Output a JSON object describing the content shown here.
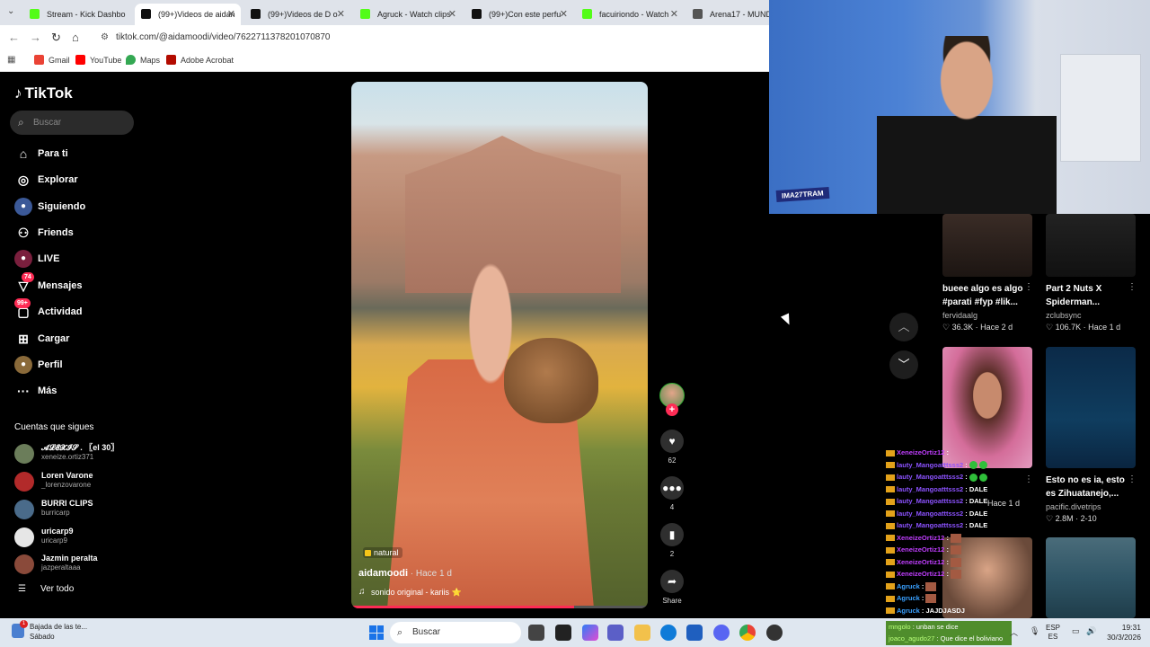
{
  "browser": {
    "tabs": [
      {
        "label": "Stream - Kick Dashbo",
        "color": "#53fc18"
      },
      {
        "label": "(99+)Videos de aidan",
        "color": "#111111",
        "active": true
      },
      {
        "label": "(99+)Videos de D o",
        "color": "#111111"
      },
      {
        "label": "Agruck - Watch clips",
        "color": "#53fc18"
      },
      {
        "label": "(99+)Con este perfu",
        "color": "#111111"
      },
      {
        "label": "facuiriondo - Watch",
        "color": "#53fc18"
      },
      {
        "label": "Arena17 - MUNDIA",
        "color": "#555555"
      }
    ],
    "url": "tiktok.com/@aidamoodi/video/7622711378201070870",
    "bookmarks": [
      {
        "label": "Gmail",
        "color": "#ea4335"
      },
      {
        "label": "YouTube",
        "color": "#ff0000"
      },
      {
        "label": "Maps",
        "color": "#34a853"
      },
      {
        "label": "Adobe Acrobat",
        "color": "#b30b00"
      }
    ]
  },
  "tiktok": {
    "logo": "TikTok",
    "search_placeholder": "Buscar",
    "menu": [
      {
        "label": "Para ti",
        "icon": "home-icon"
      },
      {
        "label": "Explorar",
        "icon": "compass-icon"
      },
      {
        "label": "Siguiendo",
        "icon": "following-icon"
      },
      {
        "label": "Friends",
        "icon": "friends-icon"
      },
      {
        "label": "LIVE",
        "icon": "live-icon"
      },
      {
        "label": "Mensajes",
        "icon": "messages-icon",
        "badge": "74"
      },
      {
        "label": "Actividad",
        "icon": "activity-icon",
        "badge": "99+"
      },
      {
        "label": "Cargar",
        "icon": "upload-icon"
      },
      {
        "label": "Perfil",
        "icon": "profile-icon"
      },
      {
        "label": "Más",
        "icon": "more-icon"
      }
    ],
    "following_title": "Cuentas que sigues",
    "accounts": [
      {
        "name": "𝓐𝓛𝓔𝓧𝓘𝓢 . 〖el 30〗",
        "handle": "xeneize.ortiz371"
      },
      {
        "name": "Loren Varone",
        "handle": "_lorenzovarone"
      },
      {
        "name": "BURRI CLIPS",
        "handle": "burricarp"
      },
      {
        "name": "uricarp9",
        "handle": "uricarp9"
      },
      {
        "name": "Jazmin peralta",
        "handle": "jazperaltaaa"
      }
    ],
    "see_all": "Ver todo",
    "video": {
      "tag": "natural",
      "author": "aidamoodi",
      "time": " · Hace 1 d",
      "sound": "sonido original - kariis ⭐",
      "progress": 0.75
    },
    "actions": {
      "likes": "62",
      "comments": "4",
      "saves": "2",
      "share": "Share"
    }
  },
  "related": [
    {
      "title": "bueee algo es algo #parati #fyp #lik...",
      "channel": "fervidaalg",
      "stats": "♡ 36.3K · Hace 2 d"
    },
    {
      "title": "Part 2 Nuts X Spiderman...",
      "channel": "zclubsync",
      "stats": "♡ 106.7K · Hace 1 d"
    },
    {
      "title": "",
      "channel": "",
      "stats": "Hace 1 d"
    },
    {
      "title": "Esto no es ia, esto es Zihuatanejo,...",
      "channel": "pacific.divetrips",
      "stats": "♡ 2.8M · 2-10"
    }
  ],
  "webcam": {
    "jersey_text": "IMA27TRAM"
  },
  "chat": [
    {
      "user": "XeneizeOrtiz12",
      "msg": ":",
      "style": "r",
      "emote": "none"
    },
    {
      "user": "lauty_Mangoatttsss2",
      "msg": ":",
      "style": "p",
      "emote": "green"
    },
    {
      "user": "lauty_Mangoatttsss2",
      "msg": ":",
      "style": "p",
      "emote": "green"
    },
    {
      "user": "lauty_Mangoatttsss2",
      "msg": ": DALE",
      "style": "p",
      "emote": "none"
    },
    {
      "user": "lauty_Mangoatttsss2",
      "msg": ": DALE",
      "style": "p",
      "emote": "none"
    },
    {
      "user": "lauty_Mangoatttsss2",
      "msg": ": DALE",
      "style": "p",
      "emote": "none"
    },
    {
      "user": "lauty_Mangoatttsss2",
      "msg": ": DALE",
      "style": "p",
      "emote": "none"
    },
    {
      "user": "XeneizeOrtiz12",
      "msg": ":",
      "style": "r",
      "emote": "face"
    },
    {
      "user": "XeneizeOrtiz12",
      "msg": ":",
      "style": "r",
      "emote": "face"
    },
    {
      "user": "XeneizeOrtiz12",
      "msg": ":",
      "style": "r",
      "emote": "face"
    },
    {
      "user": "XeneizeOrtiz12",
      "msg": ":",
      "style": "r",
      "emote": "face"
    },
    {
      "user": "Agruck",
      "msg": ":",
      "style": "b",
      "emote": "face"
    },
    {
      "user": "Agruck",
      "msg": ":",
      "style": "b",
      "emote": "face"
    },
    {
      "user": "Agruck",
      "msg": ": JAJDJASDJ",
      "style": "b",
      "emote": "none"
    }
  ],
  "gamebar": [
    {
      "user": "mngolo",
      "msg": ": unban se dice"
    },
    {
      "user": "joaco_agudo27",
      "msg": ": Que dice el boliviano"
    }
  ],
  "taskbar": {
    "notification_title": "Bajada de las te...",
    "notification_sub": "Sábado",
    "notification_badge": "1",
    "search": "Buscar",
    "lang1": "ESP",
    "lang2": "ES",
    "time": "19:31",
    "date": "30/3/2026"
  }
}
